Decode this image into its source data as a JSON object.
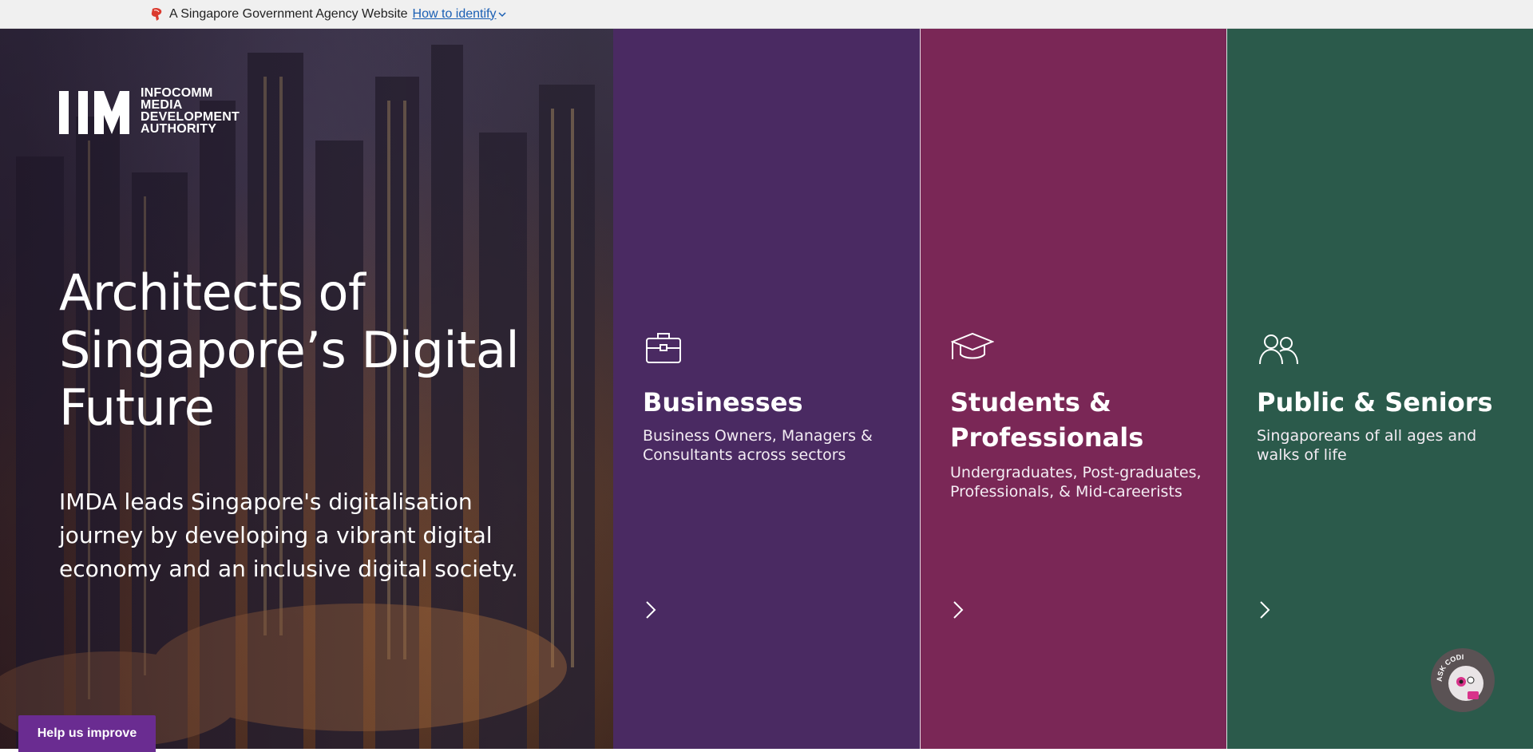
{
  "masthead": {
    "agency_text": "A Singapore Government Agency Website",
    "identify_link": "How to identify"
  },
  "logo": {
    "line1": "INFOCOMM",
    "line2": "MEDIA",
    "line3": "DEVELOPMENT",
    "line4": "AUTHORITY"
  },
  "hero": {
    "title": "Architects of Singapore’s Digital Future",
    "description": "IMDA leads Singapore's digitalisation journey by developing a vibrant digital economy and an inclusive digital society."
  },
  "panels": [
    {
      "title": "Businesses",
      "description": "Business Owners, Managers & Consultants across sectors",
      "icon": "briefcase-icon",
      "color": "#4a2a62"
    },
    {
      "title": "Students & Professionals",
      "description": "Undergraduates, Post-graduates, Professionals, & Mid-careerists",
      "icon": "graduation-cap-icon",
      "color": "#7a2756"
    },
    {
      "title": "Public & Seniors",
      "description": "Singaporeans of all ages and walks of life",
      "icon": "people-icon",
      "color": "#2b5a4b"
    }
  ],
  "feedback": {
    "label": "Help us improve"
  },
  "chatbot": {
    "label": "ASK CODI"
  },
  "colors": {
    "masthead_bg": "#f0f0f0",
    "link": "#1a5fb4",
    "feedback_bg": "#6a2c91"
  }
}
